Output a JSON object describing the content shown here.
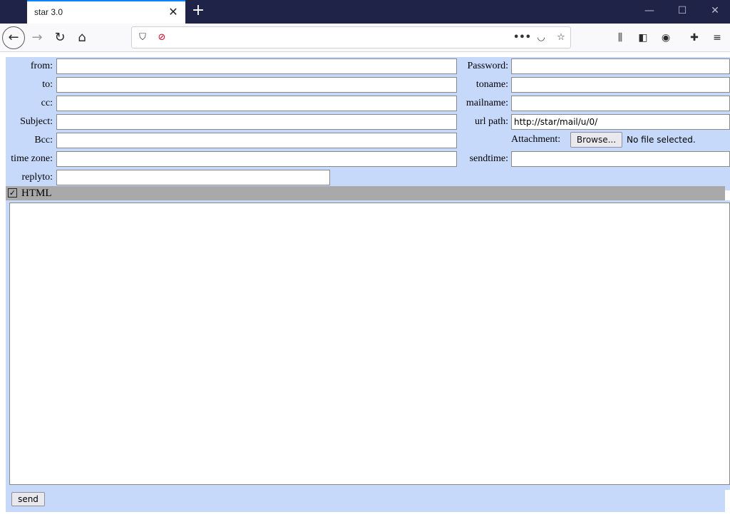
{
  "browser": {
    "tab_title": "star 3.0",
    "tab_close_icon": "close-icon",
    "new_tab_icon": "plus-icon",
    "url": "",
    "page_actions_icon": "more-icon"
  },
  "form": {
    "left": [
      {
        "label": "from:",
        "value": "",
        "field": "from"
      },
      {
        "label": "to:",
        "value": "",
        "field": "to"
      },
      {
        "label": "cc:",
        "value": "",
        "field": "cc"
      },
      {
        "label": "Subject:",
        "value": "",
        "field": "subject"
      },
      {
        "label": "Bcc:",
        "value": "",
        "field": "bcc"
      },
      {
        "label": "time zone:",
        "value": "",
        "field": "time-zone"
      },
      {
        "label": "replyto:",
        "value": "",
        "field": "replyto"
      }
    ],
    "right": [
      {
        "label": "Password:",
        "value": "",
        "field": "password"
      },
      {
        "label": "toname:",
        "value": "",
        "field": "toname"
      },
      {
        "label": "mailname:",
        "value": "",
        "field": "mailname"
      },
      {
        "label": "url path:",
        "value": "http://star/mail/u/0/",
        "field": "url-path"
      },
      {
        "label": "sendtime:",
        "value": "",
        "field": "sendtime"
      }
    ],
    "attachment": {
      "label": "Attachment:",
      "browse_label": "Browse...",
      "status": "No file selected."
    },
    "html_toggle": {
      "label": "HTML",
      "checked": true,
      "check_mark": "☑"
    },
    "body": "",
    "send_label": "send"
  },
  "colors": {
    "form_bg": "#c6d9fb",
    "html_bar_bg": "#a9a9a9",
    "titlebar_bg": "#1f2348",
    "tab_accent": "#0a84ff"
  }
}
